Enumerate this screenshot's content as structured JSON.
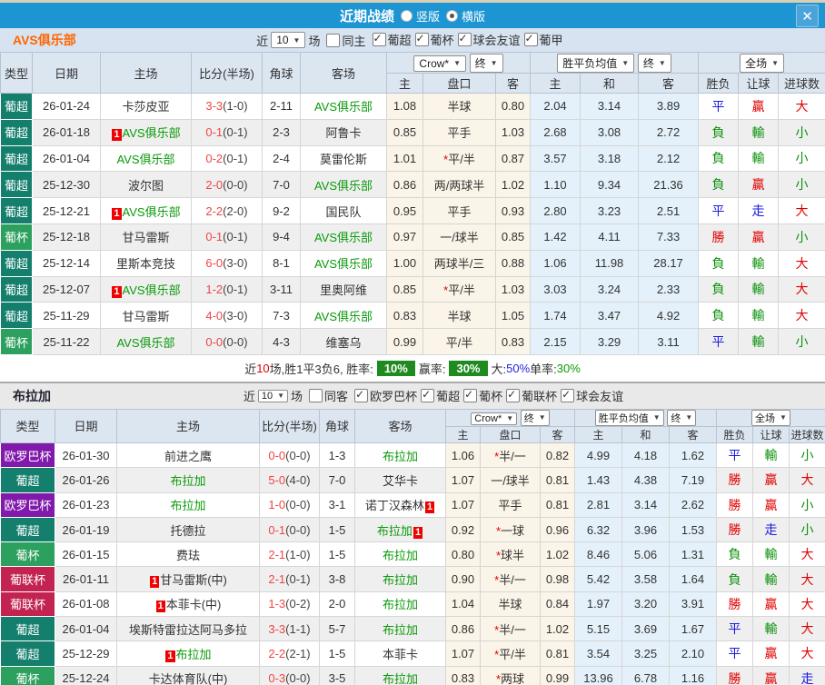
{
  "titlebar": {
    "title": "近期战绩",
    "vertical_label": "竖版",
    "horizontal_label": "横版",
    "vertical_checked": false,
    "horizontal_checked": true,
    "close_glyph": "✕"
  },
  "colors": {
    "titlebar_bg": "#1d95d3",
    "featured_team": "#0a9a0a",
    "score_red": "#f04545",
    "win_red": "#e10000",
    "lose_green": "#089008",
    "draw_blue": "#1a1ae0",
    "summary_badge_green": "#1f8a1f"
  },
  "league_colors": {
    "葡超": "#157f6d",
    "葡杯": "#2ca05e",
    "欧罗巴杯": "#8019ac",
    "葡联杯": "#c32350"
  },
  "sections": [
    {
      "team": "AVS俱乐部",
      "team_color": "#ff6600",
      "near_label": "近",
      "near_value": "10",
      "games_label": "场",
      "same": {
        "label": "同主",
        "checked": false
      },
      "leagues": [
        {
          "label": "葡超",
          "checked": true
        },
        {
          "label": "葡杯",
          "checked": true
        },
        {
          "label": "球会友谊",
          "checked": true
        },
        {
          "label": "葡甲",
          "checked": true
        }
      ],
      "header": {
        "cols": [
          "类型",
          "日期",
          "主场",
          "比分(半场)",
          "角球",
          "客场"
        ],
        "crow": "Crow*",
        "end1": "终",
        "avg": "胜平负均值",
        "end2": "终",
        "full": "全场",
        "sub": [
          "主",
          "盘口",
          "客",
          "主",
          "和",
          "客",
          "胜负",
          "让球",
          "进球数"
        ]
      },
      "rows": [
        {
          "league": "葡超",
          "date": "26-01-24",
          "home": {
            "n": "卡莎皮亚"
          },
          "ft": "3-3",
          "ht": "(1-0)",
          "corner": "2-11",
          "away": {
            "n": "AVS俱乐部",
            "f": true
          },
          "o1": "1.08",
          "hc": {
            "t": "半球"
          },
          "o2": "0.80",
          "a1": "2.04",
          "a2": "3.14",
          "a3": "3.89",
          "r": [
            [
              "平",
              "b"
            ],
            [
              "贏",
              "r"
            ],
            [
              "大",
              "r"
            ]
          ]
        },
        {
          "league": "葡超",
          "date": "26-01-18",
          "home": {
            "n": "AVS俱乐部",
            "f": true,
            "bdg": "before"
          },
          "ft": "0-1",
          "ht": "(0-1)",
          "corner": "2-3",
          "away": {
            "n": "阿鲁卡"
          },
          "o1": "0.85",
          "hc": {
            "t": "平手"
          },
          "o2": "1.03",
          "a1": "2.68",
          "a2": "3.08",
          "a3": "2.72",
          "r": [
            [
              "負",
              "g"
            ],
            [
              "輸",
              "g"
            ],
            [
              "小",
              "g"
            ]
          ]
        },
        {
          "league": "葡超",
          "date": "26-01-04",
          "home": {
            "n": "AVS俱乐部",
            "f": true
          },
          "ft": "0-2",
          "ht": "(0-1)",
          "corner": "2-4",
          "away": {
            "n": "莫雷伦斯"
          },
          "o1": "1.01",
          "hc": {
            "t": "平/半",
            "star": true
          },
          "o2": "0.87",
          "a1": "3.57",
          "a2": "3.18",
          "a3": "2.12",
          "r": [
            [
              "負",
              "g"
            ],
            [
              "輸",
              "g"
            ],
            [
              "小",
              "g"
            ]
          ]
        },
        {
          "league": "葡超",
          "date": "25-12-30",
          "home": {
            "n": "波尔图"
          },
          "ft": "2-0",
          "ht": "(0-0)",
          "corner": "7-0",
          "away": {
            "n": "AVS俱乐部",
            "f": true
          },
          "o1": "0.86",
          "hc": {
            "t": "两/两球半"
          },
          "o2": "1.02",
          "a1": "1.10",
          "a2": "9.34",
          "a3": "21.36",
          "r": [
            [
              "負",
              "g"
            ],
            [
              "贏",
              "r"
            ],
            [
              "小",
              "g"
            ]
          ]
        },
        {
          "league": "葡超",
          "date": "25-12-21",
          "home": {
            "n": "AVS俱乐部",
            "f": true,
            "bdg": "before"
          },
          "ft": "2-2",
          "ht": "(2-0)",
          "corner": "9-2",
          "away": {
            "n": "国民队"
          },
          "o1": "0.95",
          "hc": {
            "t": "平手"
          },
          "o2": "0.93",
          "a1": "2.80",
          "a2": "3.23",
          "a3": "2.51",
          "r": [
            [
              "平",
              "b"
            ],
            [
              "走",
              "b"
            ],
            [
              "大",
              "r"
            ]
          ]
        },
        {
          "league": "葡杯",
          "date": "25-12-18",
          "home": {
            "n": "甘马雷斯"
          },
          "ft": "0-1",
          "ht": "(0-1)",
          "corner": "9-4",
          "away": {
            "n": "AVS俱乐部",
            "f": true
          },
          "o1": "0.97",
          "hc": {
            "t": "一/球半"
          },
          "o2": "0.85",
          "a1": "1.42",
          "a2": "4.11",
          "a3": "7.33",
          "r": [
            [
              "勝",
              "r"
            ],
            [
              "贏",
              "r"
            ],
            [
              "小",
              "g"
            ]
          ]
        },
        {
          "league": "葡超",
          "date": "25-12-14",
          "home": {
            "n": "里斯本竞技"
          },
          "ft": "6-0",
          "ht": "(3-0)",
          "corner": "8-1",
          "away": {
            "n": "AVS俱乐部",
            "f": true
          },
          "o1": "1.00",
          "hc": {
            "t": "两球半/三"
          },
          "o2": "0.88",
          "a1": "1.06",
          "a2": "11.98",
          "a3": "28.17",
          "r": [
            [
              "負",
              "g"
            ],
            [
              "輸",
              "g"
            ],
            [
              "大",
              "r"
            ]
          ]
        },
        {
          "league": "葡超",
          "date": "25-12-07",
          "home": {
            "n": "AVS俱乐部",
            "f": true,
            "bdg": "before"
          },
          "ft": "1-2",
          "ht": "(0-1)",
          "corner": "3-11",
          "away": {
            "n": "里奥阿维"
          },
          "o1": "0.85",
          "hc": {
            "t": "平/半",
            "star": true
          },
          "o2": "1.03",
          "a1": "3.03",
          "a2": "3.24",
          "a3": "2.33",
          "r": [
            [
              "負",
              "g"
            ],
            [
              "輸",
              "g"
            ],
            [
              "大",
              "r"
            ]
          ]
        },
        {
          "league": "葡超",
          "date": "25-11-29",
          "home": {
            "n": "甘马雷斯"
          },
          "ft": "4-0",
          "ht": "(3-0)",
          "corner": "7-3",
          "away": {
            "n": "AVS俱乐部",
            "f": true
          },
          "o1": "0.83",
          "hc": {
            "t": "半球"
          },
          "o2": "1.05",
          "a1": "1.74",
          "a2": "3.47",
          "a3": "4.92",
          "r": [
            [
              "負",
              "g"
            ],
            [
              "輸",
              "g"
            ],
            [
              "大",
              "r"
            ]
          ]
        },
        {
          "league": "葡杯",
          "date": "25-11-22",
          "home": {
            "n": "AVS俱乐部",
            "f": true
          },
          "ft": "0-0",
          "ht": "(0-0)",
          "corner": "4-3",
          "away": {
            "n": "维塞乌"
          },
          "o1": "0.99",
          "hc": {
            "t": "平/半"
          },
          "o2": "0.83",
          "a1": "2.15",
          "a2": "3.29",
          "a3": "3.11",
          "r": [
            [
              "平",
              "b"
            ],
            [
              "輸",
              "g"
            ],
            [
              "小",
              "g"
            ]
          ]
        }
      ],
      "summary": [
        {
          "t": "近"
        },
        {
          "t": "10",
          "s": "red"
        },
        {
          "t": "场,胜1平3负6, 胜率:"
        },
        {
          "t": "10%",
          "s": "badge"
        },
        {
          "t": "赢率:"
        },
        {
          "t": "30%",
          "s": "badge"
        },
        {
          "t": "大:"
        },
        {
          "t": "50%",
          "s": "blue"
        },
        {
          "t": " 单率:"
        },
        {
          "t": "30%",
          "s": "green"
        }
      ]
    },
    {
      "team": "布拉加",
      "team_color": "#222233",
      "near_label": "近",
      "near_value": "10",
      "games_label": "场",
      "same": {
        "label": "同客",
        "checked": false
      },
      "leagues": [
        {
          "label": "欧罗巴杯",
          "checked": true
        },
        {
          "label": "葡超",
          "checked": true
        },
        {
          "label": "葡杯",
          "checked": true
        },
        {
          "label": "葡联杯",
          "checked": true
        },
        {
          "label": "球会友谊",
          "checked": true
        }
      ],
      "header": {
        "cols": [
          "类型",
          "日期",
          "主场",
          "比分(半场)",
          "角球",
          "客场"
        ],
        "crow": "Crow*",
        "end1": "终",
        "avg": "胜平负均值",
        "end2": "终",
        "full": "全场",
        "sub": [
          "主",
          "盘口",
          "客",
          "主",
          "和",
          "客",
          "胜负",
          "让球",
          "进球数"
        ]
      },
      "rows": [
        {
          "league": "欧罗巴杯",
          "date": "26-01-30",
          "home": {
            "n": "前进之鹰"
          },
          "ft": "0-0",
          "ht": "(0-0)",
          "corner": "1-3",
          "away": {
            "n": "布拉加",
            "f": true
          },
          "o1": "1.06",
          "hc": {
            "t": "半/一",
            "star": true
          },
          "o2": "0.82",
          "a1": "4.99",
          "a2": "4.18",
          "a3": "1.62",
          "r": [
            [
              "平",
              "b"
            ],
            [
              "輸",
              "g"
            ],
            [
              "小",
              "g"
            ]
          ]
        },
        {
          "league": "葡超",
          "date": "26-01-26",
          "home": {
            "n": "布拉加",
            "f": true
          },
          "ft": "5-0",
          "ht": "(4-0)",
          "corner": "7-0",
          "away": {
            "n": "艾华卡"
          },
          "o1": "1.07",
          "hc": {
            "t": "一/球半"
          },
          "o2": "0.81",
          "a1": "1.43",
          "a2": "4.38",
          "a3": "7.19",
          "r": [
            [
              "勝",
              "r"
            ],
            [
              "贏",
              "r"
            ],
            [
              "大",
              "r"
            ]
          ]
        },
        {
          "league": "欧罗巴杯",
          "date": "26-01-23",
          "home": {
            "n": "布拉加",
            "f": true
          },
          "ft": "1-0",
          "ht": "(0-0)",
          "corner": "3-1",
          "away": {
            "n": "诺丁汉森林",
            "bdg": "after"
          },
          "o1": "1.07",
          "hc": {
            "t": "平手"
          },
          "o2": "0.81",
          "a1": "2.81",
          "a2": "3.14",
          "a3": "2.62",
          "r": [
            [
              "勝",
              "r"
            ],
            [
              "贏",
              "r"
            ],
            [
              "小",
              "g"
            ]
          ]
        },
        {
          "league": "葡超",
          "date": "26-01-19",
          "home": {
            "n": "托德拉"
          },
          "ft": "0-1",
          "ht": "(0-0)",
          "corner": "1-5",
          "away": {
            "n": "布拉加",
            "f": true,
            "bdg": "after"
          },
          "o1": "0.92",
          "hc": {
            "t": "一球",
            "star": true
          },
          "o2": "0.96",
          "a1": "6.32",
          "a2": "3.96",
          "a3": "1.53",
          "r": [
            [
              "勝",
              "r"
            ],
            [
              "走",
              "b"
            ],
            [
              "小",
              "g"
            ]
          ]
        },
        {
          "league": "葡杯",
          "date": "26-01-15",
          "home": {
            "n": "费珐"
          },
          "ft": "2-1",
          "ht": "(1-0)",
          "corner": "1-5",
          "away": {
            "n": "布拉加",
            "f": true
          },
          "o1": "0.80",
          "hc": {
            "t": "球半",
            "star": true
          },
          "o2": "1.02",
          "a1": "8.46",
          "a2": "5.06",
          "a3": "1.31",
          "r": [
            [
              "負",
              "g"
            ],
            [
              "輸",
              "g"
            ],
            [
              "大",
              "r"
            ]
          ]
        },
        {
          "league": "葡联杯",
          "date": "26-01-11",
          "home": {
            "n": "甘马雷斯(中)",
            "bdg": "before"
          },
          "ft": "2-1",
          "ht": "(0-1)",
          "corner": "3-8",
          "away": {
            "n": "布拉加",
            "f": true
          },
          "o1": "0.90",
          "hc": {
            "t": "半/一",
            "star": true
          },
          "o2": "0.98",
          "a1": "5.42",
          "a2": "3.58",
          "a3": "1.64",
          "r": [
            [
              "負",
              "g"
            ],
            [
              "輸",
              "g"
            ],
            [
              "大",
              "r"
            ]
          ]
        },
        {
          "league": "葡联杯",
          "date": "26-01-08",
          "home": {
            "n": "本菲卡(中)",
            "bdg": "before"
          },
          "ft": "1-3",
          "ht": "(0-2)",
          "corner": "2-0",
          "away": {
            "n": "布拉加",
            "f": true
          },
          "o1": "1.04",
          "hc": {
            "t": "半球"
          },
          "o2": "0.84",
          "a1": "1.97",
          "a2": "3.20",
          "a3": "3.91",
          "r": [
            [
              "勝",
              "r"
            ],
            [
              "贏",
              "r"
            ],
            [
              "大",
              "r"
            ]
          ]
        },
        {
          "league": "葡超",
          "date": "26-01-04",
          "home": {
            "n": "埃斯特雷拉达阿马多拉"
          },
          "ft": "3-3",
          "ht": "(1-1)",
          "corner": "5-7",
          "away": {
            "n": "布拉加",
            "f": true
          },
          "o1": "0.86",
          "hc": {
            "t": "半/一",
            "star": true
          },
          "o2": "1.02",
          "a1": "5.15",
          "a2": "3.69",
          "a3": "1.67",
          "r": [
            [
              "平",
              "b"
            ],
            [
              "輸",
              "g"
            ],
            [
              "大",
              "r"
            ]
          ]
        },
        {
          "league": "葡超",
          "date": "25-12-29",
          "home": {
            "n": "布拉加",
            "f": true,
            "bdg": "before"
          },
          "ft": "2-2",
          "ht": "(2-1)",
          "corner": "1-5",
          "away": {
            "n": "本菲卡"
          },
          "o1": "1.07",
          "hc": {
            "t": "平/半",
            "star": true
          },
          "o2": "0.81",
          "a1": "3.54",
          "a2": "3.25",
          "a3": "2.10",
          "r": [
            [
              "平",
              "b"
            ],
            [
              "贏",
              "r"
            ],
            [
              "大",
              "r"
            ]
          ]
        },
        {
          "league": "葡杯",
          "date": "25-12-24",
          "home": {
            "n": "卡达体育队(中)"
          },
          "ft": "0-3",
          "ht": "(0-0)",
          "corner": "3-5",
          "away": {
            "n": "布拉加",
            "f": true
          },
          "o1": "0.83",
          "hc": {
            "t": "两球",
            "star": true
          },
          "o2": "0.99",
          "a1": "13.96",
          "a2": "6.78",
          "a3": "1.16",
          "r": [
            [
              "勝",
              "r"
            ],
            [
              "贏",
              "r"
            ],
            [
              "走",
              "b"
            ]
          ]
        }
      ],
      "summary": null
    }
  ]
}
